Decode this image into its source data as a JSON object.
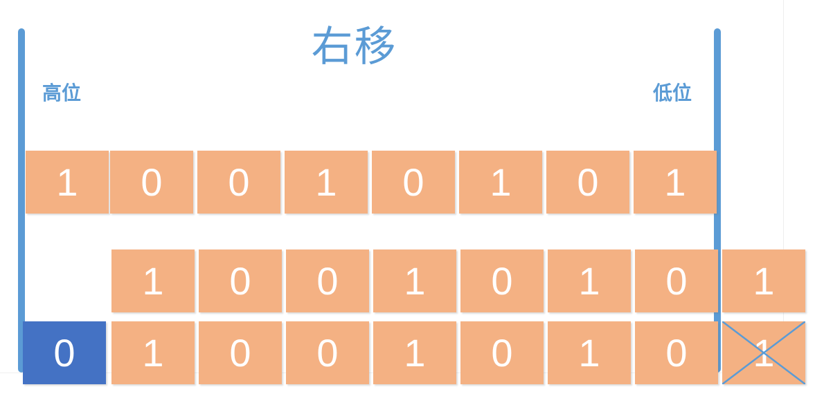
{
  "title": "右移",
  "labels": {
    "high": "高位",
    "low": "低位"
  },
  "rows": {
    "original": [
      "1",
      "0",
      "0",
      "1",
      "0",
      "1",
      "0",
      "1"
    ],
    "shifted": [
      "1",
      "0",
      "0",
      "1",
      "0",
      "1",
      "0",
      "1"
    ],
    "result": {
      "fill_bit": "0",
      "bits": [
        "1",
        "0",
        "0",
        "1",
        "0",
        "1",
        "0"
      ],
      "dropped_bit": "1"
    }
  },
  "colors": {
    "accent": "#5b9bd5",
    "cell": "#f4b183",
    "fill_cell": "#4472c4",
    "text": "#ffffff"
  }
}
